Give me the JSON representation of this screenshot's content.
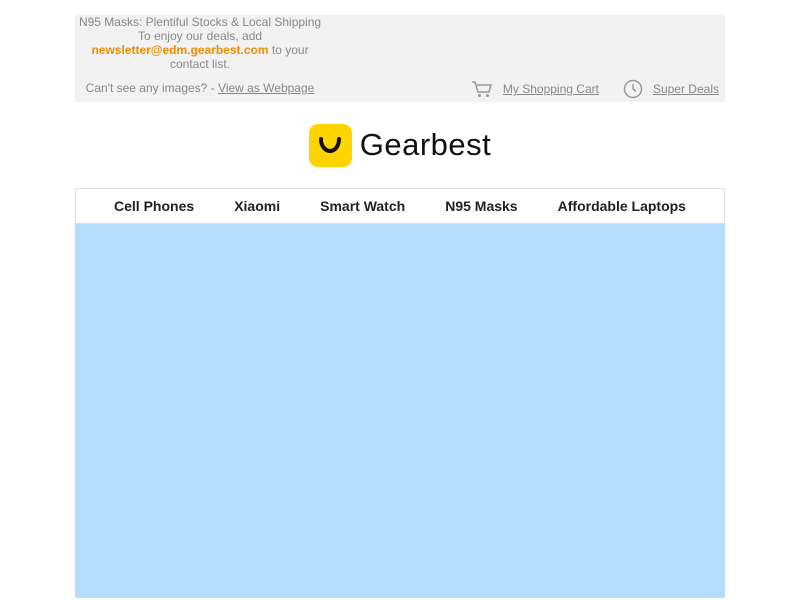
{
  "header": {
    "headline": "N95 Masks: Plentiful Stocks & Local Shipping",
    "enjoy_text": "To enjoy our deals, add",
    "email": "newsletter@edm.gearbest.com",
    "contact_text": "to your contact list.",
    "cant_see_text": "Can't see any images? -",
    "view_webpage": "View as Webpage",
    "cart_label": "My Shopping Cart",
    "deals_label": "Super Deals",
    "cart_icon": "cart-icon",
    "deals_icon": "clock-icon"
  },
  "brand": {
    "name": "Gearbest",
    "accent_color": "#ffd400"
  },
  "nav": {
    "items": [
      {
        "label": "Cell Phones"
      },
      {
        "label": "Xiaomi"
      },
      {
        "label": "Smart Watch"
      },
      {
        "label": "N95 Masks"
      },
      {
        "label": "Affordable Laptops"
      }
    ]
  },
  "banner": {
    "background_color": "#b6ddfd"
  }
}
